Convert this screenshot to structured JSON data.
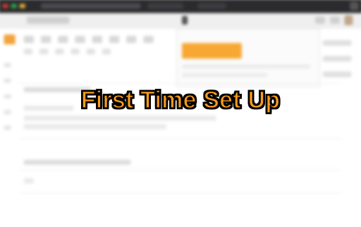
{
  "overlay": {
    "title": "First Time Set Up"
  },
  "colors": {
    "title_fill": "#f89a1c",
    "title_outline": "#000000",
    "accent_orange": "#f7a834",
    "top_bar": "#2b2b2e"
  }
}
